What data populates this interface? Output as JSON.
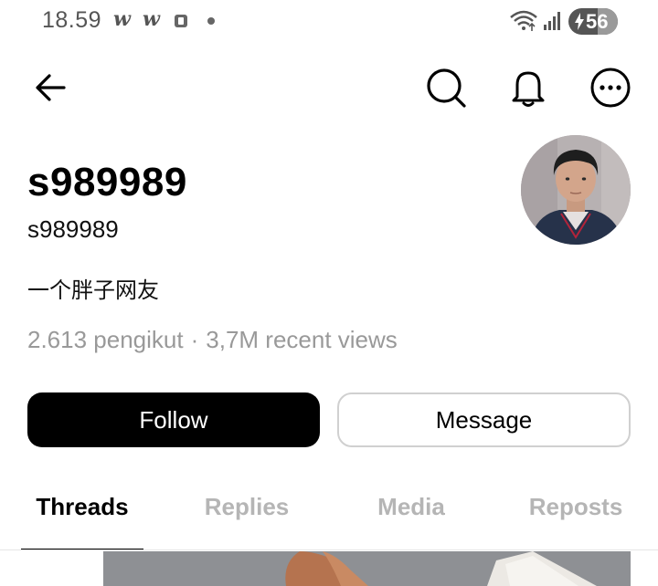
{
  "status_bar": {
    "time": "18.59",
    "notification_1": "w",
    "notification_2": "w",
    "battery_level": "56",
    "icons": [
      "w-app-icon",
      "w-app-icon",
      "small-app-icon",
      "dot-icon",
      "wifi-icon",
      "signal-icon",
      "battery-charging-icon"
    ]
  },
  "top_bar": {
    "icons": [
      "arrow-left-icon",
      "search-icon",
      "bell-icon",
      "more-icon"
    ]
  },
  "profile": {
    "display_name": "s989989",
    "username": "s989989",
    "bio": "一个胖子网友",
    "followers": "2.613 pengikut",
    "separator": "·",
    "views": "3,7M recent views"
  },
  "actions": {
    "follow_label": "Follow",
    "message_label": "Message"
  },
  "tabs": [
    {
      "label": "Threads",
      "active": true
    },
    {
      "label": "Replies",
      "active": false
    },
    {
      "label": "Media",
      "active": false
    },
    {
      "label": "Reposts",
      "active": false
    }
  ],
  "colors": {
    "primary": "#000000",
    "muted_text": "#999999",
    "inactive_tab": "#b5b5b5",
    "border": "#d0d0d0"
  }
}
